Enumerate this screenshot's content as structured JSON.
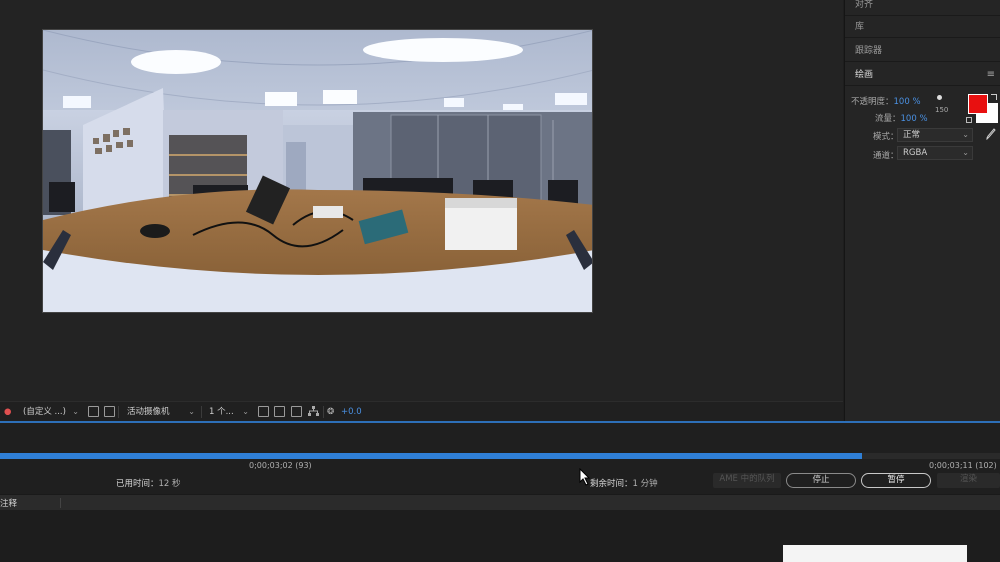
{
  "panels": {
    "align": "对齐",
    "library": "库",
    "tracker": "跟踪器",
    "paint": "绘画",
    "menu_icon": "≡"
  },
  "paint": {
    "opacity_label": "不透明度：",
    "opacity_value": "100 %",
    "flow_label": "流量：",
    "flow_value": "100 %",
    "brush_size": "150",
    "mode_label": "模式：",
    "mode_value": "正常",
    "channel_label": "通道：",
    "channel_value": "RGBA",
    "fg_color": "#e81010",
    "bg_color": "#ffffff"
  },
  "viewer_toolbar": {
    "resolution": "(自定义 ...)",
    "camera": "活动摄像机",
    "views": "1 个...",
    "exposure": "+0.0"
  },
  "render_queue": {
    "progress": 0.862,
    "current_timecode": "0;00;03;02 (93)",
    "end_timecode": "0;00;03;11 (102)",
    "elapsed_label": "已用时间：",
    "elapsed_value": "12 秒",
    "remaining_label": "剩余时间：",
    "remaining_value": "1 分钟",
    "ame_button": "AME 中的队列",
    "stop_button": "停止",
    "pause_button": "暂停",
    "render_button": "渲染",
    "comment_header": "注释"
  }
}
